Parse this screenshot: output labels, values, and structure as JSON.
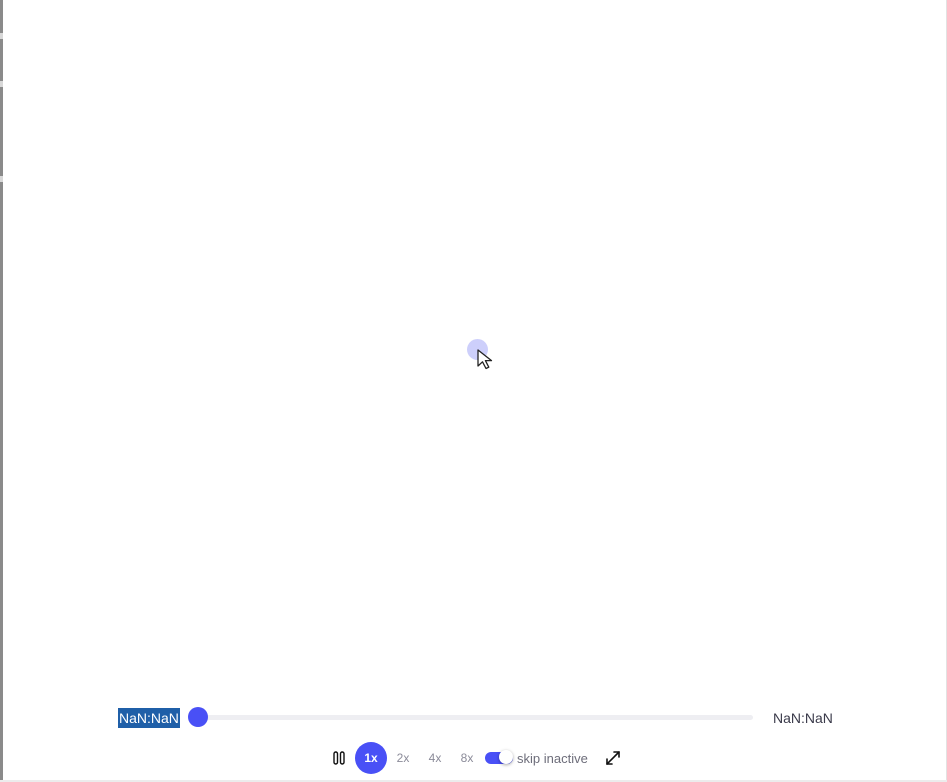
{
  "controller": {
    "current_time": "NaN:NaN",
    "total_time": "NaN:NaN",
    "progress": 0,
    "speeds": [
      "1x",
      "2x",
      "4x",
      "8x"
    ],
    "active_speed": "1x",
    "skip_inactive": {
      "label": "skip inactive",
      "enabled": true
    }
  },
  "icons": {
    "pause": "pause-icon",
    "fullscreen": "fullscreen-icon",
    "cursor": "mouse-cursor-icon"
  },
  "colors": {
    "accent": "#4950f6",
    "time_highlight": "#1f5fa8"
  }
}
